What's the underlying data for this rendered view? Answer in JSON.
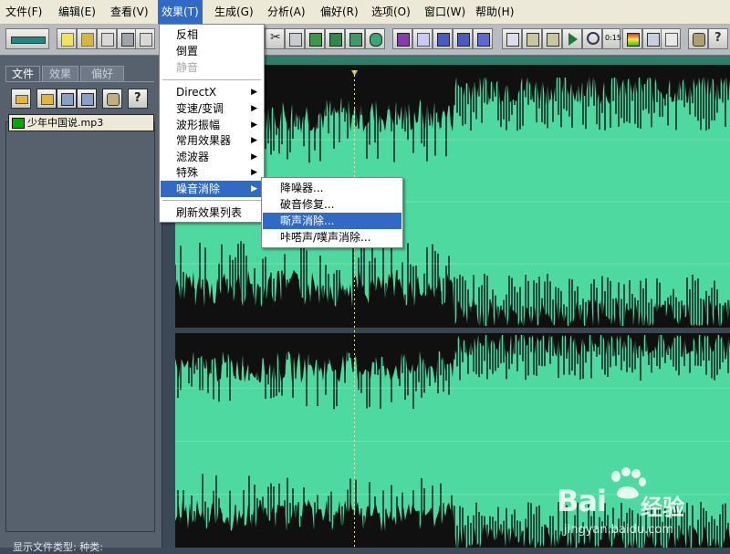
{
  "menubar": {
    "items": [
      "文件(F)",
      "编辑(E)",
      "查看(V)",
      "效果(T)",
      "生成(G)",
      "分析(A)",
      "偏好(R)",
      "选项(O)",
      "窗口(W)",
      "帮助(H)"
    ],
    "active_index": 3
  },
  "toolbar": {
    "icons": [
      "waveform-view-icon",
      "new-file-icon",
      "open-file-icon",
      "close-file-icon",
      "save-file-icon",
      "save-as-icon",
      "cut-icon",
      "paste-icon",
      "copy-icon",
      "mix-paste-icon",
      "trim-icon",
      "go-to-icon",
      "envelope-icon",
      "select-icon",
      "grid-icon",
      "grid-alt-icon",
      "grid-3-icon",
      "spectral-view-icon",
      "frame-icon",
      "frame-alt-icon",
      "play-icon",
      "zoom-icon",
      "time-icon",
      "meter-icon",
      "window-icon",
      "settings-icon",
      "help-icon"
    ]
  },
  "left_panel": {
    "tabs": [
      "文件",
      "效果",
      "偏好"
    ],
    "active_tab": 0,
    "buttons": [
      "open-folder-icon",
      "close-file-icon",
      "insert-icon",
      "mixer-icon",
      "settings-icon",
      "help-icon"
    ],
    "files": [
      "少年中国说.mp3"
    ],
    "status": "显示文件类型:  种类:"
  },
  "effects_menu": {
    "items": [
      {
        "label": "反相",
        "enabled": true,
        "submenu": false
      },
      {
        "label": "倒置",
        "enabled": true,
        "submenu": false
      },
      {
        "label": "静音",
        "enabled": false,
        "submenu": false
      },
      {
        "label": "DirectX",
        "enabled": true,
        "submenu": true
      },
      {
        "label": "变速/变调",
        "enabled": true,
        "submenu": true
      },
      {
        "label": "波形振幅",
        "enabled": true,
        "submenu": true
      },
      {
        "label": "常用效果器",
        "enabled": true,
        "submenu": true
      },
      {
        "label": "滤波器",
        "enabled": true,
        "submenu": true
      },
      {
        "label": "特殊",
        "enabled": true,
        "submenu": true
      },
      {
        "label": "噪音消除",
        "enabled": true,
        "submenu": true,
        "highlighted": true
      },
      {
        "label": "刷新效果列表",
        "enabled": true,
        "submenu": false
      }
    ]
  },
  "noise_submenu": {
    "items": [
      {
        "label": "降噪器...",
        "highlighted": false
      },
      {
        "label": "破音修复...",
        "highlighted": false
      },
      {
        "label": "嘶声消除...",
        "highlighted": true
      },
      {
        "label": "咔嗒声/噗声消除...",
        "highlighted": false
      }
    ]
  },
  "waveform": {
    "wave_color": "#4dd9a0",
    "background_color": "#101010",
    "channels": 2
  },
  "watermark": {
    "brand": "Bai",
    "brand_cn": "经验",
    "url": "jingyan.baidu.com"
  },
  "colors": {
    "menu_highlight": "#316ac5",
    "panel_bg": "#56616d"
  }
}
